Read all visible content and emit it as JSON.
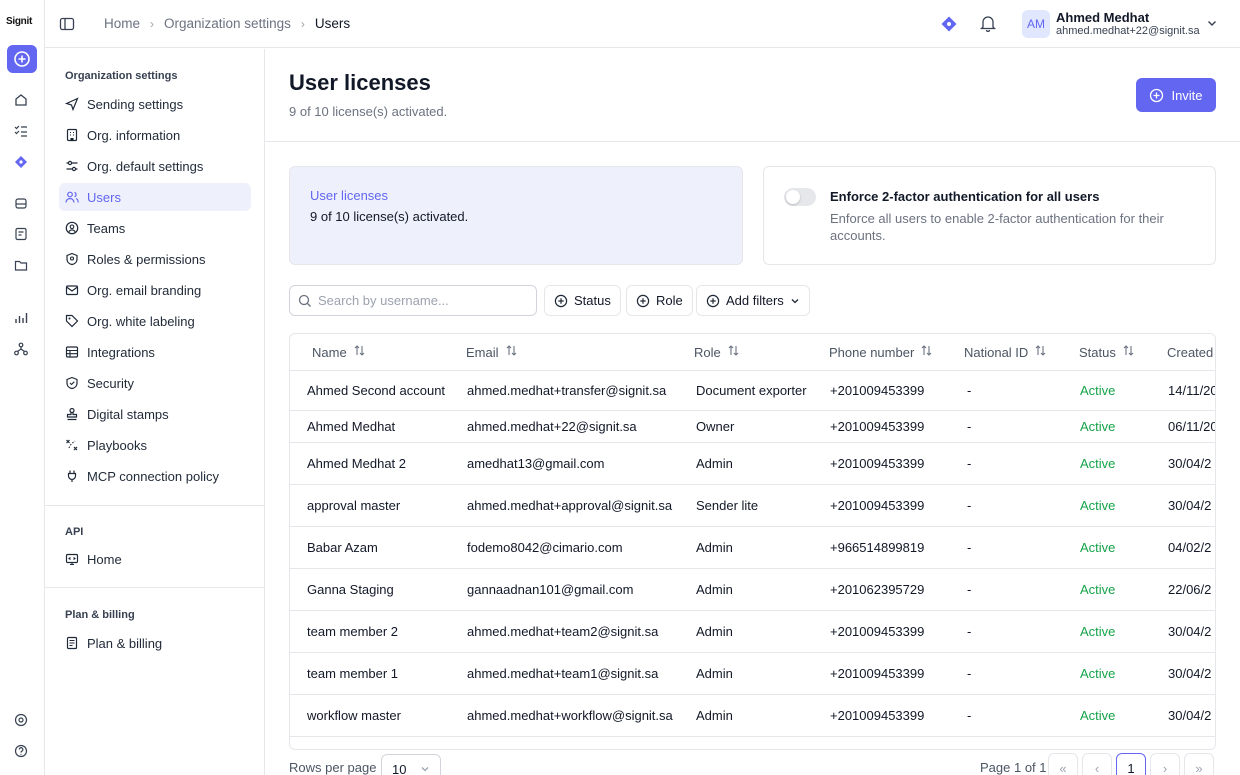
{
  "app": {
    "logo": "Signit"
  },
  "breadcrumb": [
    "Home",
    "Organization settings",
    "Users"
  ],
  "user": {
    "initials": "AM",
    "name": "Ahmed Medhat",
    "email": "ahmed.medhat+22@signit.sa"
  },
  "sidebar": {
    "groups": [
      {
        "label": "Organization settings"
      },
      {
        "label": "API"
      },
      {
        "label": "Plan & billing"
      }
    ],
    "items": [
      {
        "label": "Sending settings",
        "icon": "send-icon"
      },
      {
        "label": "Org. information",
        "icon": "building-icon"
      },
      {
        "label": "Org. default settings",
        "icon": "sliders-icon"
      },
      {
        "label": "Users",
        "icon": "users-icon",
        "active": true
      },
      {
        "label": "Teams",
        "icon": "team-icon"
      },
      {
        "label": "Roles & permissions",
        "icon": "shield-icon"
      },
      {
        "label": "Org. email branding",
        "icon": "mail-icon"
      },
      {
        "label": "Org. white labeling",
        "icon": "tag-icon"
      },
      {
        "label": "Integrations",
        "icon": "grid-icon"
      },
      {
        "label": "Security",
        "icon": "shield-check-icon"
      },
      {
        "label": "Digital stamps",
        "icon": "stamp-icon"
      },
      {
        "label": "Playbooks",
        "icon": "playbook-icon"
      },
      {
        "label": "MCP connection policy",
        "icon": "plug-icon"
      }
    ],
    "api_items": [
      {
        "label": "Home",
        "icon": "api-home-icon"
      }
    ],
    "billing_items": [
      {
        "label": "Plan & billing",
        "icon": "receipt-icon"
      }
    ]
  },
  "page": {
    "title": "User licenses",
    "subtitle": "9 of 10 license(s) activated.",
    "invite_label": "Invite"
  },
  "license_card": {
    "title": "User licenses",
    "text": "9 of 10 license(s) activated."
  },
  "twofa_card": {
    "title": "Enforce 2-factor authentication for all users",
    "text": "Enforce all users to enable 2-factor authentication for their accounts.",
    "enabled": false
  },
  "filters": {
    "search_placeholder": "Search by username...",
    "status_label": "Status",
    "role_label": "Role",
    "add_filters_label": "Add filters"
  },
  "table": {
    "columns": [
      "Name",
      "Email",
      "Role",
      "Phone number",
      "National ID",
      "Status",
      "Created"
    ],
    "rows": [
      [
        "Ahmed Second account",
        "ahmed.medhat+transfer@signit.sa",
        "Document exporter",
        "+201009453399",
        "-",
        "Active",
        "14/11/20"
      ],
      [
        "Ahmed Medhat",
        "ahmed.medhat+22@signit.sa",
        "Owner",
        "+201009453399",
        "-",
        "Active",
        "06/11/20"
      ],
      [
        "Ahmed Medhat 2",
        "amedhat13@gmail.com",
        "Admin",
        "+201009453399",
        "-",
        "Active",
        "30/04/2"
      ],
      [
        "approval master",
        "ahmed.medhat+approval@signit.sa",
        "Sender lite",
        "+201009453399",
        "-",
        "Active",
        "30/04/2"
      ],
      [
        "Babar Azam",
        "fodemo8042@cimario.com",
        "Admin",
        "+966514899819",
        "-",
        "Active",
        "04/02/2"
      ],
      [
        "Ganna Staging",
        "gannaadnan101@gmail.com",
        "Admin",
        "+201062395729",
        "-",
        "Active",
        "22/06/2"
      ],
      [
        "team member 2",
        "ahmed.medhat+team2@signit.sa",
        "Admin",
        "+201009453399",
        "-",
        "Active",
        "30/04/2"
      ],
      [
        "team member 1",
        "ahmed.medhat+team1@signit.sa",
        "Admin",
        "+201009453399",
        "-",
        "Active",
        "30/04/2"
      ],
      [
        "workflow master",
        "ahmed.medhat+workflow@signit.sa",
        "Admin",
        "+201009453399",
        "-",
        "Active",
        "30/04/2"
      ]
    ]
  },
  "pagination": {
    "rows_per_page_label": "Rows per page",
    "rows_per_page": "10",
    "page_info": "Page 1 of 1",
    "current_page": "1"
  },
  "colors": {
    "accent": "#6366f1",
    "active_status": "#16a34a",
    "card_bg": "#eef0fb"
  }
}
